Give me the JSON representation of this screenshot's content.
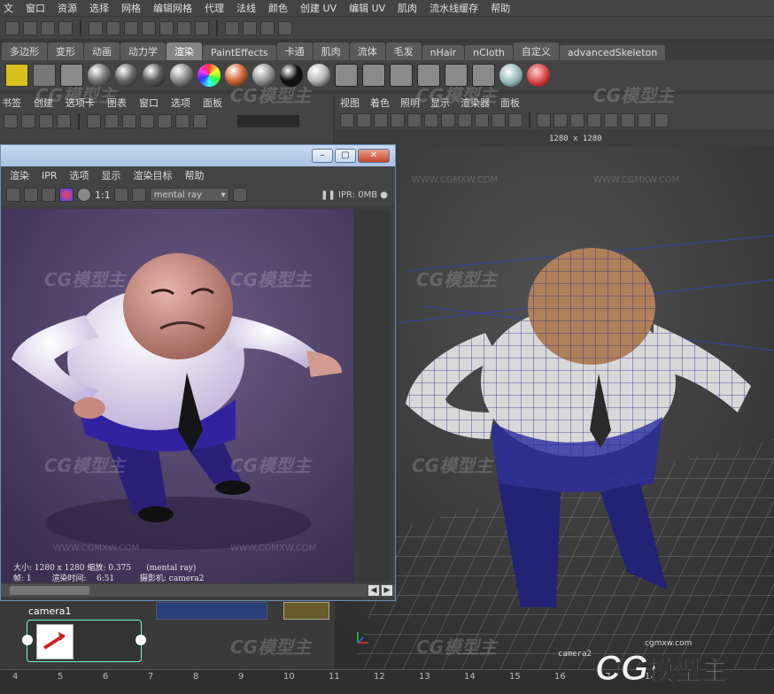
{
  "menubar": [
    "文",
    "窗口",
    "资源",
    "选择",
    "网格",
    "编辑网格",
    "代理",
    "法线",
    "颜色",
    "创建 UV",
    "编辑 UV",
    "肌肉",
    "流水线缓存",
    "帮助"
  ],
  "shelf_tabs": [
    {
      "label": "多边形",
      "active": false
    },
    {
      "label": "变形",
      "active": false
    },
    {
      "label": "动画",
      "active": false
    },
    {
      "label": "动力学",
      "active": false
    },
    {
      "label": "渲染",
      "active": true
    },
    {
      "label": "PaintEffects",
      "active": false
    },
    {
      "label": "卡通",
      "active": false
    },
    {
      "label": "肌肉",
      "active": false
    },
    {
      "label": "流体",
      "active": false
    },
    {
      "label": "毛发",
      "active": false
    },
    {
      "label": "nHair",
      "active": false
    },
    {
      "label": "nCloth",
      "active": false
    },
    {
      "label": "自定义",
      "active": false
    },
    {
      "label": "advancedSkeleton",
      "active": false
    }
  ],
  "shelf_colors": [
    "#7a7a7a",
    "#6a6a6a",
    "#5e5e5e",
    "#8f8f8f",
    "#c8c8c8",
    "#d66b3a",
    "#9a9a9a",
    "#111111",
    "#bbbbbb"
  ],
  "left_panel_menu": [
    "书签",
    "创建",
    "选项卡",
    "图表",
    "窗口",
    "选项",
    "面板"
  ],
  "viewport": {
    "menu": [
      "视图",
      "着色",
      "照明",
      "显示",
      "渲染器",
      "面板"
    ],
    "resolution": "1280 x 1280",
    "camera": "camera2"
  },
  "render_window": {
    "menu": [
      "渲染",
      "IPR",
      "选项",
      "显示",
      "渲染目标",
      "帮助"
    ],
    "renderer": "mental ray",
    "ratio": "1:1",
    "ipr": "IPR: 0MB",
    "info": {
      "size_label": "大小:",
      "size": "1280 x 1280",
      "zoom_label": "缩放:",
      "zoom": "0.375",
      "renderer_tag": "(mental ray)",
      "frame_label": "帧:",
      "frame": "1",
      "time_label": "渲染时间:",
      "time": "6:51",
      "cam_label": "摄影机:",
      "camera": "camera2"
    }
  },
  "node_editor": {
    "camera_label": "camera1"
  },
  "timeline_ticks": [
    "4",
    "5",
    "6",
    "7",
    "8",
    "9",
    "10",
    "11",
    "12",
    "13",
    "14",
    "15",
    "16",
    "17",
    "18"
  ],
  "watermark": {
    "brand": "CG模型主",
    "url": "WWW.CGMXW.COM",
    "logo_url": "cgmxw.com"
  }
}
